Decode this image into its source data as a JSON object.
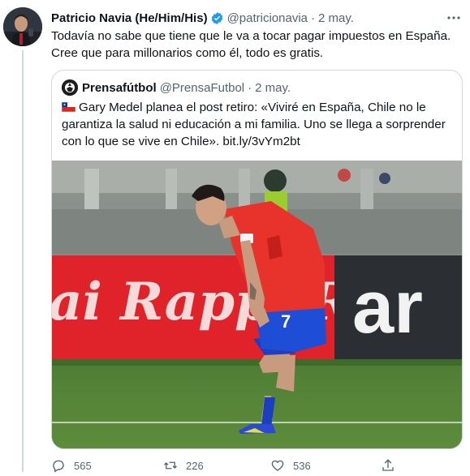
{
  "tweet": {
    "author_name": "Patricio Navia (He/Him/His)",
    "handle": "@patricionavia",
    "separator": "·",
    "date": "2 may.",
    "text": "Todavía no sabe que tiene que le va a tocar pagar impuestos en España. Cree que para millonarios como él, todo es gratis."
  },
  "quote": {
    "author_name": "Prensafútbol",
    "handle": "@PrensaFutbol",
    "separator": "·",
    "date": "2 may.",
    "text": "Gary Medel planea el post retiro: «Viviré en España, Chile no le garantiza la salud ni educación a mi familia. Uno se llega a sorprender con lo que se vive en Chile».",
    "link": "bit.ly/3vYm2bt",
    "image_banner_text": "ai Rappi R",
    "image_board_text": "ar",
    "player_number": "7"
  },
  "actions": {
    "replies": "565",
    "retweets": "226",
    "likes": "536"
  },
  "icons": {
    "verified": "verified-badge-icon",
    "more": "more-icon",
    "reply": "reply-icon",
    "retweet": "retweet-icon",
    "like": "like-icon",
    "share": "share-icon",
    "flag": "chile-flag-icon"
  },
  "colors": {
    "verified_blue": "#1d9bf0",
    "muted": "#536471",
    "border": "#cfd9de",
    "chile_red": "#d52b1e",
    "chile_blue": "#0039a6"
  }
}
